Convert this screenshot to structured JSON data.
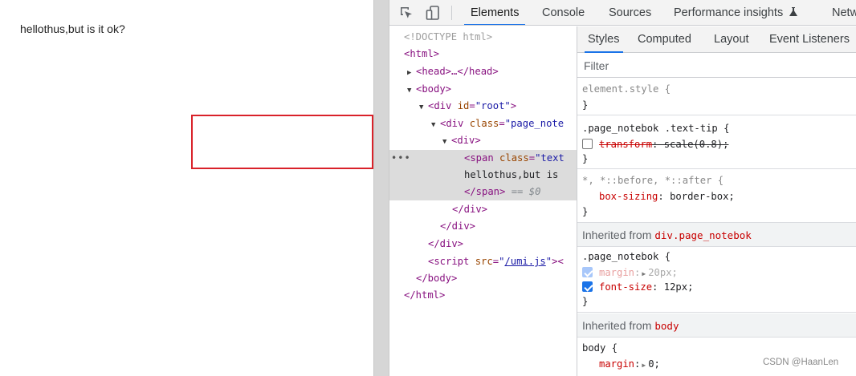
{
  "page": {
    "text": "hellothus,but is it ok?"
  },
  "devtools": {
    "tabs": [
      "Elements",
      "Console",
      "Sources",
      "Performance insights",
      "Netw"
    ],
    "elements_tree": {
      "doctype": "<!DOCTYPE html>",
      "html_open": "<html>",
      "head": "<head>…</head>",
      "body_open": "<body>",
      "div_root": {
        "open": "<div ",
        "attr": "id",
        "eq": "=",
        "val": "\"root\"",
        "close": ">"
      },
      "div_notebook": {
        "open": "<div ",
        "attr": "class",
        "eq": "=",
        "val": "\"page_note"
      },
      "div_inner": "<div>",
      "span": {
        "open": "<span ",
        "attr": "class",
        "eq": "=",
        "val": "\"text"
      },
      "span_text": "hellothus,but is",
      "span_close": "</span>",
      "eq_dollar": "== $0",
      "div_close_1": "</div>",
      "div_close_2": "</div>",
      "div_close_3": "</div>",
      "script": {
        "open": "<script ",
        "attr": "src",
        "eq": "=",
        "quote_open": "\"",
        "link": "/umi.js",
        "quote_close": "\"",
        "close": "><"
      },
      "body_close": "</body>",
      "html_close": "</html>",
      "dots": "•••"
    },
    "styles_tabs": [
      "Styles",
      "Computed",
      "Layout",
      "Event Listeners"
    ],
    "filter_placeholder": "Filter",
    "rules": {
      "element_style": {
        "selector": "element.style {",
        "close": "}"
      },
      "text_tip": {
        "selector": ".page_notebok .text-tip {",
        "prop": "transform",
        "value": ": scale(0.8);",
        "close": "}",
        "checked": false
      },
      "universal": {
        "selector": "*, *::before, *::after {",
        "prop": "box-sizing",
        "value": "border-box;",
        "close": "}"
      },
      "inherited_1": {
        "label": "Inherited from",
        "source": "div.page_notebok"
      },
      "notebok": {
        "selector": ".page_notebok {",
        "prop1": "margin",
        "value1": "20px;",
        "prop2": "font-size",
        "value2": "12px;",
        "close": "}"
      },
      "inherited_2": {
        "label": "Inherited from",
        "source": "body"
      },
      "body_rule": {
        "selector": "body {",
        "prop1": "margin",
        "value1": "0;"
      }
    }
  },
  "watermark": "CSDN @HaanLen",
  "colors": {
    "accent": "#1a73e8",
    "highlight_border": "#d9222a",
    "property": "#c80000"
  }
}
